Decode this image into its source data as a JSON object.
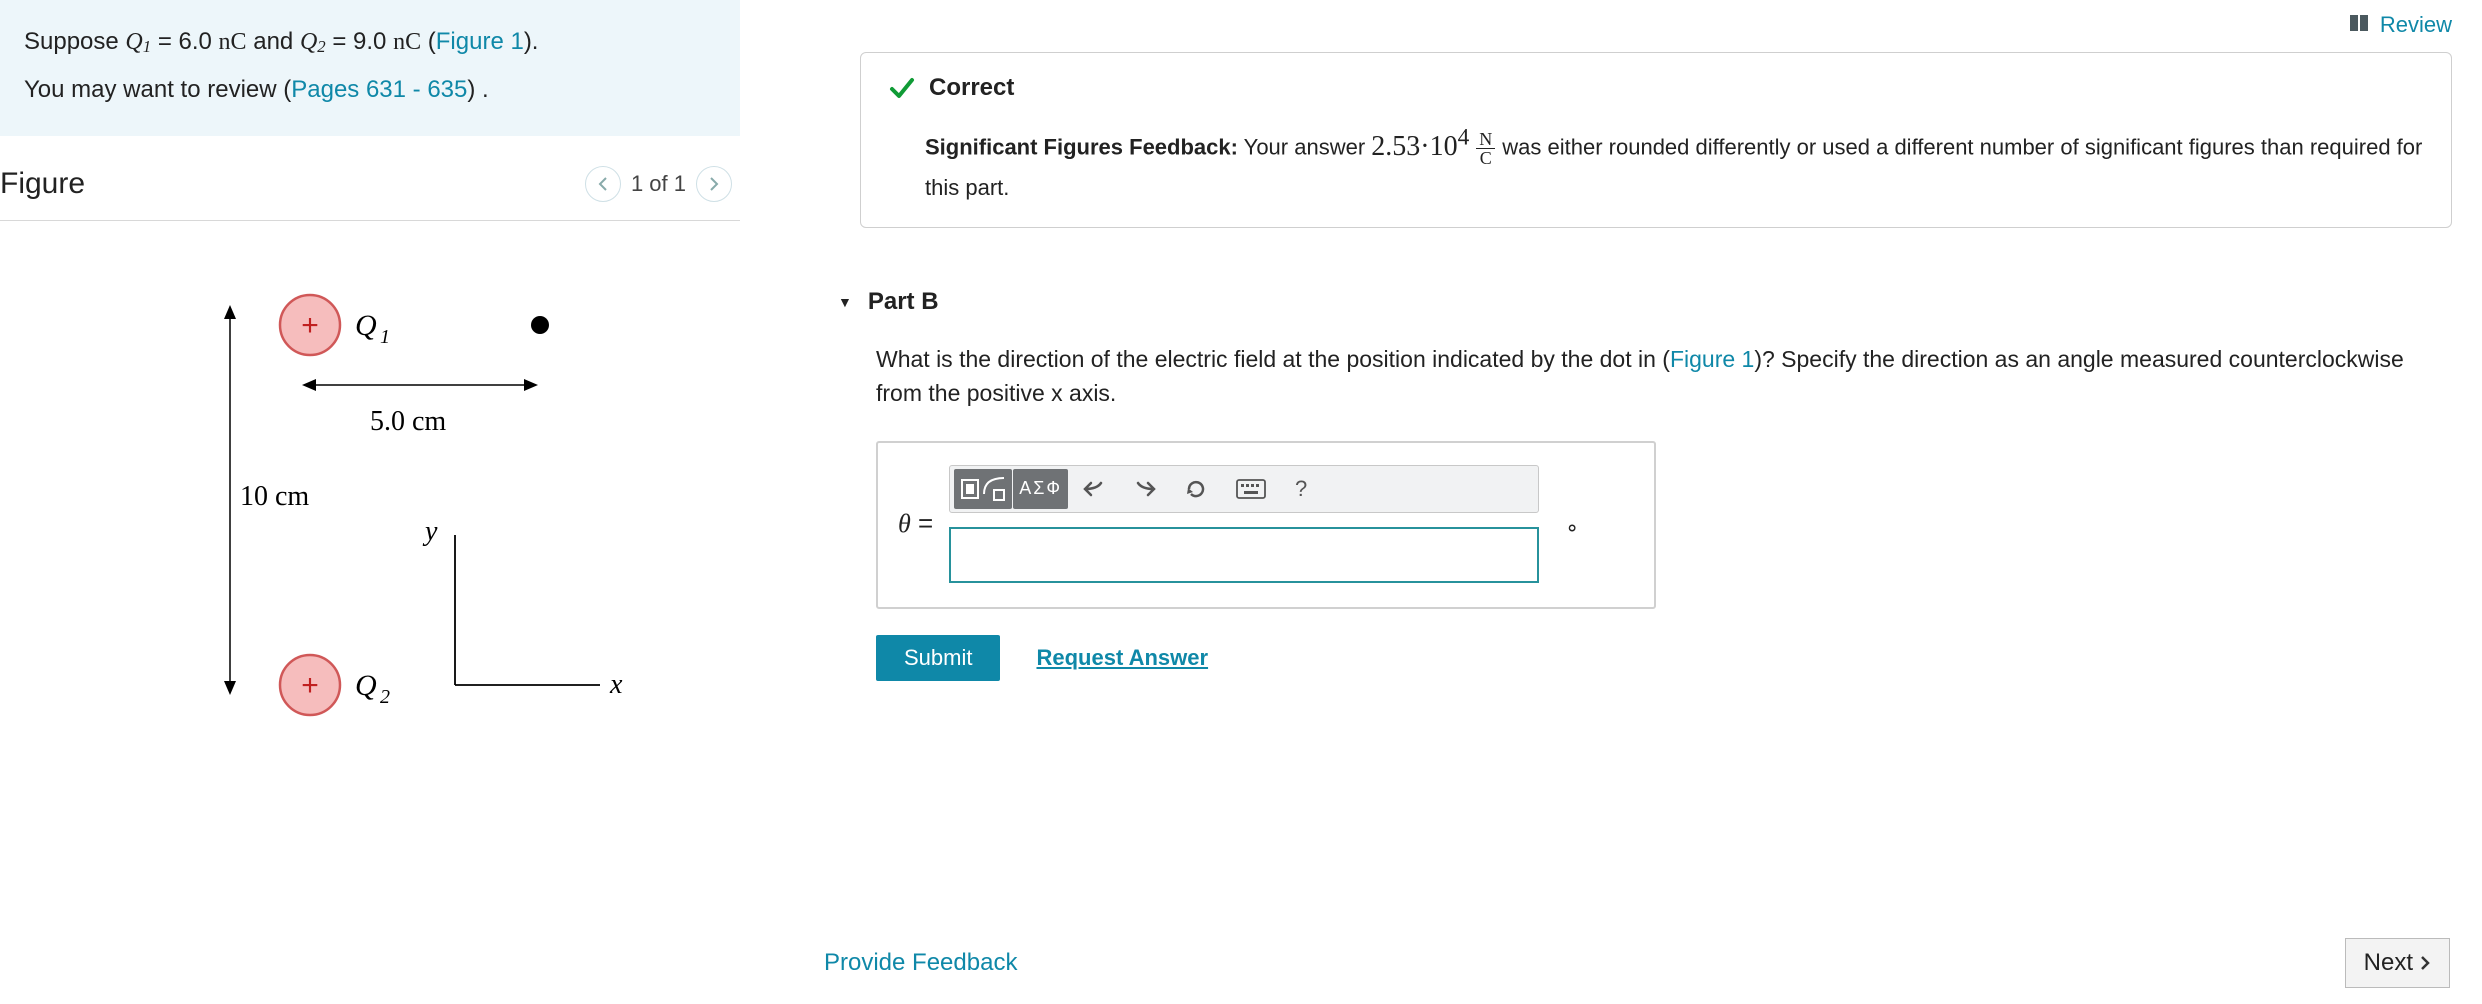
{
  "review_link": "Review",
  "prompt": {
    "line1_pre": "Suppose ",
    "q1_sym_main": "Q",
    "q1_sym_sub": "1",
    "q1_eq": " = 6.0 ",
    "q1_unit": "nC",
    "and": " and ",
    "q2_sym_main": "Q",
    "q2_sym_sub": "2",
    "q2_eq": " = 9.0 ",
    "q2_unit": "nC",
    "line1_post_open": " (",
    "figure_link": "Figure 1",
    "line1_post_close": ").",
    "line2_pre": "You may want to review (",
    "pages_link": "Pages 631 - 635",
    "line2_post": ") ."
  },
  "figure": {
    "title": "Figure",
    "pager_text": "1 of 1",
    "labels": {
      "q1": "Q₁",
      "q2": "Q₂",
      "dx": "5.0 cm",
      "dy": "10 cm",
      "y": "y",
      "x": "x"
    }
  },
  "feedback": {
    "correct_label": "Correct",
    "sigfig_label": "Significant Figures Feedback:",
    "pre": " Your answer ",
    "value": "2.53·10",
    "exp": "4",
    "unit_num": "N",
    "unit_den": "C",
    "post": " was either rounded differently or used a different number of significant figures than required for this part."
  },
  "partB": {
    "header": "Part B",
    "question_pre": "What is the direction of the electric field at the position indicated by the dot in (",
    "figure_link": "Figure 1",
    "question_mid": ")? Specify the direction as an angle measured counterclockwise from the positive ",
    "xvar": "x",
    "question_post": " axis.",
    "theta_sym": "θ",
    "equals": " =",
    "deg": "∘",
    "submit": "Submit",
    "request": "Request Answer",
    "toolbar": {
      "sigma": "ΑΣФ",
      "help": "?"
    }
  },
  "footer": {
    "provide_feedback": "Provide Feedback",
    "next": "Next"
  }
}
